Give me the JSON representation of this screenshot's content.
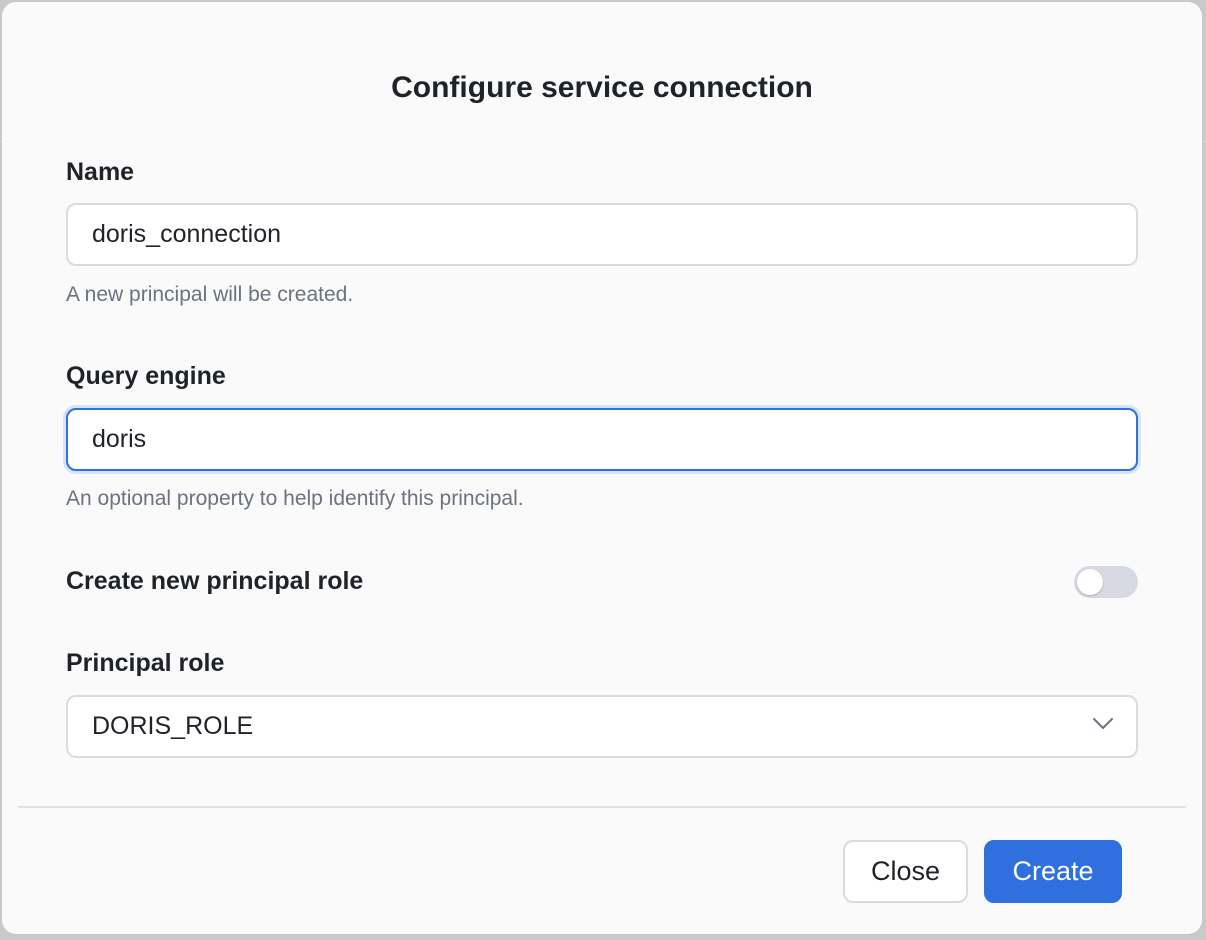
{
  "dialog": {
    "title": "Configure service connection"
  },
  "fields": {
    "name": {
      "label": "Name",
      "value": "doris_connection",
      "hint": "A new principal will be created."
    },
    "query_engine": {
      "label": "Query engine",
      "value": "doris",
      "hint": "An optional property to help identify this principal."
    },
    "create_role": {
      "label": "Create new principal role",
      "enabled": false
    },
    "principal_role": {
      "label": "Principal role",
      "selected": "DORIS_ROLE"
    }
  },
  "footer": {
    "close_label": "Close",
    "create_label": "Create"
  },
  "colors": {
    "accent": "#2f6fde",
    "toggle_off": "#d7dae2"
  },
  "icons": {
    "select": "chevron-down-icon"
  }
}
